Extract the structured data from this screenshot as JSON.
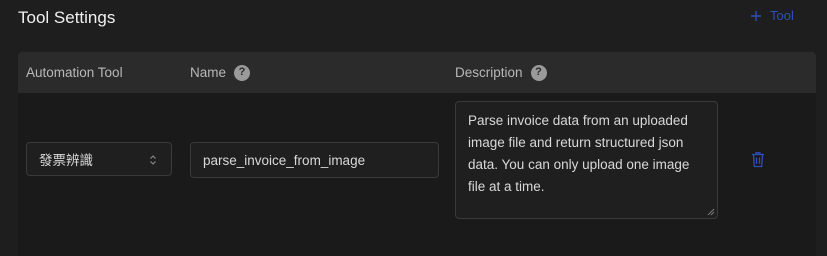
{
  "section": {
    "title": "Tool Settings",
    "add_tool_label": "Tool"
  },
  "table": {
    "columns": [
      {
        "label": "Automation Tool"
      },
      {
        "label": "Name"
      },
      {
        "label": "Description"
      }
    ],
    "rows": [
      {
        "automation_tool": "發票辨識",
        "name": "parse_invoice_from_image",
        "description": "Parse invoice data from an uploaded image file and return structured json data. You can only upload one image file at a time."
      }
    ]
  },
  "colors": {
    "accent": "#2f4fb8",
    "background": "#1e1e1e",
    "header_background": "#2b2b2b"
  },
  "icons": {
    "add": "plus-icon",
    "help": "question-circle-icon",
    "select": "chevron-up-down-icon",
    "delete": "trash-icon",
    "resize": "resize-handle-icon"
  }
}
